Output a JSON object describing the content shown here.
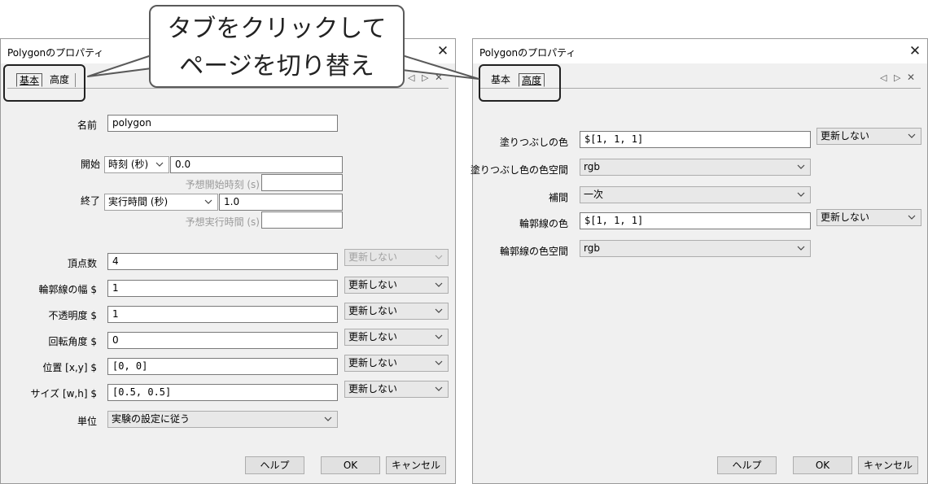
{
  "callout": {
    "line1": "タブをクリックして",
    "line2": "ページを切り替え"
  },
  "left_dialog": {
    "title": "Polygonのプロパティ",
    "tabs": [
      {
        "label": "基本",
        "active": true
      },
      {
        "label": "高度",
        "active": false
      }
    ],
    "name": {
      "label": "名前",
      "value": "polygon"
    },
    "start": {
      "label": "開始",
      "type": "時刻 (秒)",
      "value": "0.0",
      "expected_label": "予想開始時刻 (s)",
      "expected_value": ""
    },
    "stop": {
      "label": "終了",
      "type": "実行時間 (秒)",
      "value": "1.0",
      "expected_label": "予想実行時間 (s)",
      "expected_value": ""
    },
    "params": [
      {
        "label": "頂点数",
        "value": "4",
        "update": "更新しない",
        "disabled": true
      },
      {
        "label": "輪郭線の幅 $",
        "value": "1",
        "update": "更新しない",
        "disabled": false
      },
      {
        "label": "不透明度 $",
        "value": "1",
        "update": "更新しない",
        "disabled": false
      },
      {
        "label": "回転角度 $",
        "value": "0",
        "update": "更新しない",
        "disabled": false
      },
      {
        "label": "位置 [x,y] $",
        "value": "[0, 0]",
        "update": "更新しない",
        "disabled": false
      },
      {
        "label": "サイズ [w,h] $",
        "value": "[0.5, 0.5]",
        "update": "更新しない",
        "disabled": false
      }
    ],
    "units": {
      "label": "単位",
      "value": "実験の設定に従う"
    },
    "buttons": {
      "help": "ヘルプ",
      "ok": "OK",
      "cancel": "キャンセル"
    }
  },
  "right_dialog": {
    "title": "Polygonのプロパティ",
    "tabs": [
      {
        "label": "基本",
        "active": false
      },
      {
        "label": "高度",
        "active": true
      }
    ],
    "fill_color": {
      "label": "塗りつぶしの色",
      "value": "$[1, 1, 1]",
      "update": "更新しない"
    },
    "fill_color_space": {
      "label": "塗りつぶし色の色空間",
      "value": "rgb"
    },
    "interpolate": {
      "label": "補間",
      "value": "一次"
    },
    "line_color": {
      "label": "輪郭線の色",
      "value": "$[1, 1, 1]",
      "update": "更新しない"
    },
    "line_color_space": {
      "label": "輪郭線の色空間",
      "value": "rgb"
    },
    "buttons": {
      "help": "ヘルプ",
      "ok": "OK",
      "cancel": "キャンセル"
    }
  },
  "icons": {
    "close": "close-icon",
    "tab_prev": "triangle-left-icon",
    "tab_next": "triangle-right-icon",
    "dropdown": "chevron-down-icon"
  },
  "colors": {
    "dialog_bg": "#f0f0f0",
    "titlebar_bg": "#ffffff",
    "disabled_text": "#a0a0a0"
  }
}
